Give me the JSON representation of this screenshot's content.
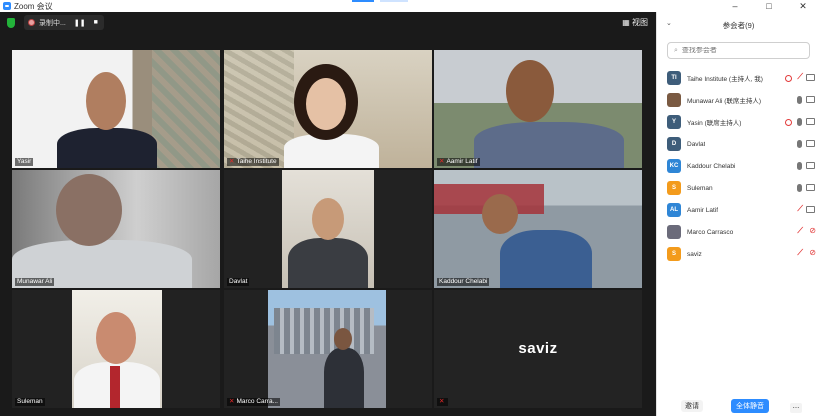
{
  "window": {
    "title": "Zoom 会议",
    "controls": [
      "–",
      "□",
      "✕"
    ]
  },
  "meeting": {
    "recording_label": "录制中...",
    "pause_label": "❚❚",
    "stop_label": "■",
    "view_label": "视图",
    "view_icon": "grid-icon"
  },
  "tiles": [
    {
      "name": "Yasir",
      "muted": false
    },
    {
      "name": "Taihe Institute",
      "muted": true
    },
    {
      "name": "Aamir Latif",
      "muted": true
    },
    {
      "name": "Munawar Ali",
      "muted": false
    },
    {
      "name": "Davlat",
      "muted": false
    },
    {
      "name": "Kaddour Chelabi",
      "muted": false
    },
    {
      "name": "Suleman",
      "muted": false
    },
    {
      "name": "Marco Carra...",
      "muted": true
    },
    {
      "name": "",
      "display_name": "saviz",
      "muted": true
    }
  ],
  "participants_panel": {
    "title": "参会者(9)",
    "search_placeholder": "查找参会者",
    "participants": [
      {
        "initials": "TI",
        "avatar_color": "#3e5d7a",
        "name": "Taihe Institute (主持人, 我)",
        "recording": true,
        "mic_muted": true,
        "cam_off": false
      },
      {
        "initials": "",
        "avatar_color": "#7a5a42",
        "name": "Munawar Ali (联席主持人)",
        "recording": false,
        "mic_muted": false,
        "cam_off": false
      },
      {
        "initials": "Y",
        "avatar_color": "#3e5d7a",
        "name": "Yasin (联席主持人)",
        "recording": true,
        "mic_muted": false,
        "cam_off": false
      },
      {
        "initials": "D",
        "avatar_color": "#3e5d7a",
        "name": "Davlat",
        "recording": false,
        "mic_muted": false,
        "cam_off": false
      },
      {
        "initials": "KC",
        "avatar_color": "#2f86d6",
        "name": "Kaddour Chelabi",
        "recording": false,
        "mic_muted": false,
        "cam_off": false
      },
      {
        "initials": "S",
        "avatar_color": "#f39b1c",
        "name": "Suleman",
        "recording": false,
        "mic_muted": false,
        "cam_off": false
      },
      {
        "initials": "AL",
        "avatar_color": "#2f86d6",
        "name": "Aamir Latif",
        "recording": false,
        "mic_muted": true,
        "cam_off": false
      },
      {
        "initials": "",
        "avatar_color": "#6b6b7a",
        "name": "Marco Carrasco",
        "recording": false,
        "mic_muted": true,
        "cam_off": true
      },
      {
        "initials": "S",
        "avatar_color": "#f39b1c",
        "name": "saviz",
        "recording": false,
        "mic_muted": true,
        "cam_off": true
      }
    ],
    "invite_label": "邀请",
    "mute_all_label": "全体静音",
    "more_label": "..."
  }
}
